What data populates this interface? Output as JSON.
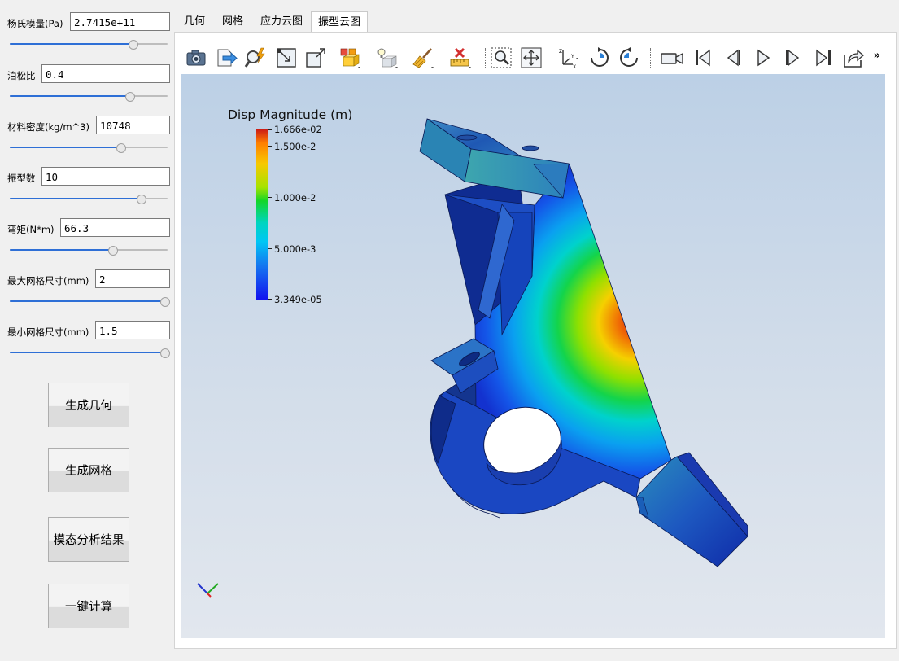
{
  "params": [
    {
      "label": "杨氏模量(Pa)",
      "value": "2.7415e+11",
      "slider": 0.78
    },
    {
      "label": "泊松比",
      "value": "0.4",
      "slider": 0.76
    },
    {
      "label": "材料密度(kg/m^3)",
      "value": "10748",
      "slider": 0.7
    },
    {
      "label": "振型数",
      "value": "10",
      "slider": 0.83
    },
    {
      "label": "弯矩(N*m)",
      "value": "66.3",
      "slider": 0.65
    },
    {
      "label": "最大网格尺寸(mm)",
      "value": "2",
      "slider": 1.0
    },
    {
      "label": "最小网格尺寸(mm)",
      "value": "1.5",
      "slider": 1.0
    }
  ],
  "buttons": [
    "生成几何",
    "生成网格",
    "模态分析结果",
    "一键计算"
  ],
  "tabs": [
    "几何",
    "网格",
    "应力云图",
    "振型云图"
  ],
  "active_tab": "振型云图",
  "toolbar_icons": [
    "camera-icon",
    "export-icon",
    "zoom-lightning-icon",
    "box-corner-icon",
    "box-arrow-icon",
    "cube-stack-icon",
    "light-cube-icon",
    "box-cube-icon",
    "broom-icon",
    "ruler-x-icon",
    "zoom-box-icon",
    "fit-arrows-icon",
    "axes-xyz-icon",
    "rotate-cw-icon",
    "rotate-ccw-icon",
    "video-camera-icon",
    "first-frame-icon",
    "prev-frame-icon",
    "play-icon",
    "next-frame-icon",
    "last-frame-icon",
    "share-icon"
  ],
  "toolbar_more": "»",
  "legend": {
    "title": "Disp Magnitude (m)",
    "labels": [
      "1.666e-02",
      "1.500e-2",
      "1.000e-2",
      "5.000e-3",
      "3.349e-05"
    ]
  },
  "colors": {
    "accent": "#2e6fd6",
    "colormap_top": "#cc1b15",
    "colormap_bottom": "#1212ef"
  }
}
